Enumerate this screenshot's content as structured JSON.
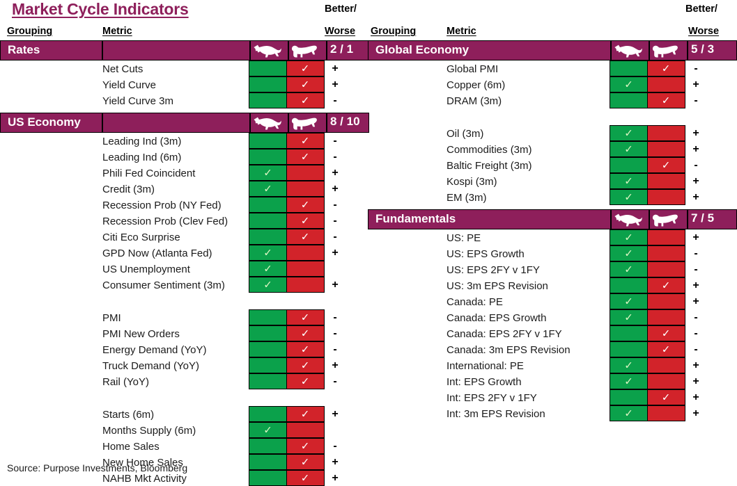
{
  "title": "Market Cycle Indicators",
  "source": "Source: Purpose Investments, Bloomberg",
  "header": {
    "grouping_label": "Grouping",
    "metric_label": "Metric",
    "better_label": "Better/",
    "worse_label": "Worse",
    "bull_icon": "bull-icon",
    "bear_icon": "bear-icon"
  },
  "colors": {
    "brand_purple": "#8E1F5B",
    "bull_green": "#0BA14B",
    "bear_red": "#D2232A",
    "text": "#1b1b1b"
  },
  "columns": [
    {
      "id": "left",
      "groups": [
        {
          "name": "Rates",
          "score": "2 / 1",
          "rows": [
            {
              "metric": "Net Cuts",
              "signal": "bear",
              "change": "+"
            },
            {
              "metric": "Yield Curve",
              "signal": "bear",
              "change": "+"
            },
            {
              "metric": "Yield Curve 3m",
              "signal": "bear",
              "change": "-"
            }
          ]
        },
        {
          "name": "US Economy",
          "score": "8 / 10",
          "blocks": [
            {
              "rows": [
                {
                  "metric": "Leading Ind (3m)",
                  "signal": "bear",
                  "change": "-"
                },
                {
                  "metric": "Leading Ind (6m)",
                  "signal": "bear",
                  "change": "-"
                },
                {
                  "metric": "Phili Fed Coincident",
                  "signal": "bull",
                  "change": "+"
                },
                {
                  "metric": "Credit (3m)",
                  "signal": "bull",
                  "change": "+"
                },
                {
                  "metric": "Recession Prob (NY Fed)",
                  "signal": "bear",
                  "change": "-"
                },
                {
                  "metric": "Recession Prob (Clev Fed)",
                  "signal": "bear",
                  "change": "-"
                },
                {
                  "metric": "Citi Eco Surprise",
                  "signal": "bear",
                  "change": "-"
                },
                {
                  "metric": "GPD Now (Atlanta Fed)",
                  "signal": "bull",
                  "change": "+"
                },
                {
                  "metric": "US Unemployment",
                  "signal": "bull",
                  "change": ""
                },
                {
                  "metric": "Consumer Sentiment (3m)",
                  "signal": "bull",
                  "change": "+"
                }
              ]
            },
            {
              "rows": [
                {
                  "metric": "PMI",
                  "signal": "bear",
                  "change": "-"
                },
                {
                  "metric": "PMI New Orders",
                  "signal": "bear",
                  "change": "-"
                },
                {
                  "metric": "Energy Demand (YoY)",
                  "signal": "bear",
                  "change": "-"
                },
                {
                  "metric": "Truck Demand (YoY)",
                  "signal": "bear",
                  "change": "+"
                },
                {
                  "metric": "Rail (YoY)",
                  "signal": "bear",
                  "change": "-"
                }
              ]
            },
            {
              "rows": [
                {
                  "metric": "Starts (6m)",
                  "signal": "bear",
                  "change": "+"
                },
                {
                  "metric": "Months Supply (6m)",
                  "signal": "bull",
                  "change": ""
                },
                {
                  "metric": "Home Sales",
                  "signal": "bear",
                  "change": "-"
                },
                {
                  "metric": "New Home Sales",
                  "signal": "bear",
                  "change": "+"
                },
                {
                  "metric": "NAHB Mkt Activity",
                  "signal": "bear",
                  "change": "+"
                }
              ]
            }
          ]
        }
      ]
    },
    {
      "id": "right",
      "groups": [
        {
          "name": "Global Economy",
          "score": "5 / 3",
          "blocks": [
            {
              "rows": [
                {
                  "metric": "Global PMI",
                  "signal": "bear",
                  "change": "-"
                },
                {
                  "metric": "Copper (6m)",
                  "signal": "bull",
                  "change": "+"
                },
                {
                  "metric": "DRAM (3m)",
                  "signal": "bear",
                  "change": "-"
                }
              ]
            },
            {
              "rows": [
                {
                  "metric": "Oil (3m)",
                  "signal": "bull",
                  "change": "+"
                },
                {
                  "metric": "Commodities (3m)",
                  "signal": "bull",
                  "change": "+"
                },
                {
                  "metric": "Baltic Freight (3m)",
                  "signal": "bear",
                  "change": "-"
                },
                {
                  "metric": "Kospi (3m)",
                  "signal": "bull",
                  "change": "+"
                },
                {
                  "metric": "EM (3m)",
                  "signal": "bull",
                  "change": "+"
                }
              ]
            }
          ]
        },
        {
          "name": "Fundamentals",
          "score": "7 / 5",
          "rows": [
            {
              "metric": "US: PE",
              "signal": "bull",
              "change": "+"
            },
            {
              "metric": "US: EPS Growth",
              "signal": "bull",
              "change": "-"
            },
            {
              "metric": "US: EPS 2FY v 1FY",
              "signal": "bull",
              "change": "-"
            },
            {
              "metric": "US: 3m EPS Revision",
              "signal": "bear",
              "change": "+"
            },
            {
              "metric": "Canada: PE",
              "signal": "bull",
              "change": "+"
            },
            {
              "metric": "Canada: EPS Growth",
              "signal": "bull",
              "change": "-"
            },
            {
              "metric": "Canada: EPS 2FY v 1FY",
              "signal": "bear",
              "change": "-"
            },
            {
              "metric": "Canada: 3m EPS Revision",
              "signal": "bear",
              "change": "-"
            },
            {
              "metric": "International: PE",
              "signal": "bull",
              "change": "+"
            },
            {
              "metric": "Int: EPS Growth",
              "signal": "bull",
              "change": "+"
            },
            {
              "metric": "Int: EPS 2FY v 1FY",
              "signal": "bear",
              "change": "+"
            },
            {
              "metric": "Int: 3m EPS Revision",
              "signal": "bull",
              "change": "+"
            }
          ]
        }
      ]
    }
  ],
  "tick_glyph": "✓"
}
